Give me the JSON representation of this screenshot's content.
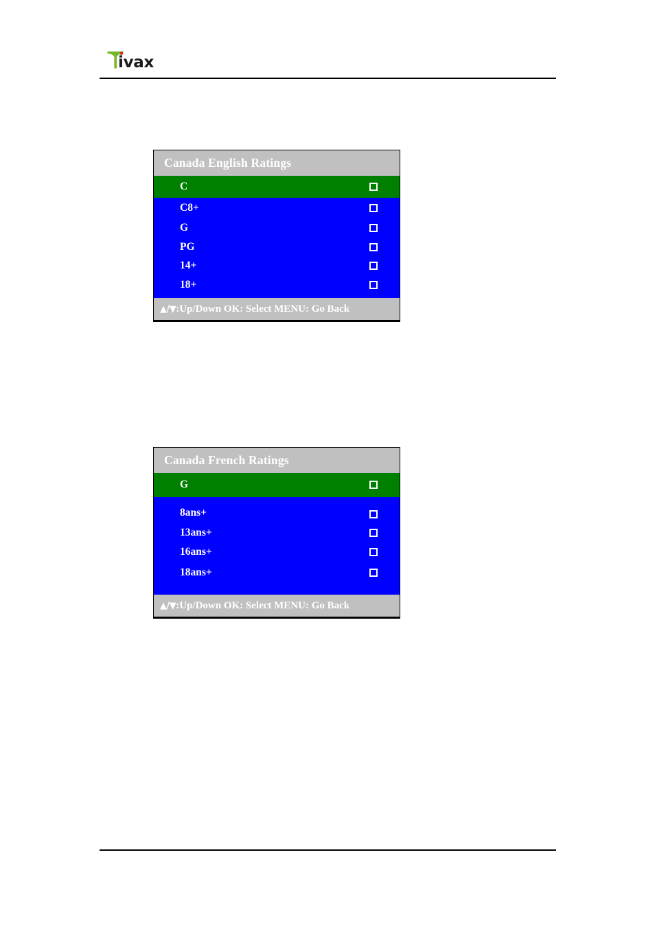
{
  "brand": {
    "logo_text": "ivax",
    "logo_mark": "tivax-t-icon",
    "logo_dot_color": "#d42e12",
    "logo_mark_color": "#76b82a"
  },
  "colors": {
    "header_bg": "#c0c0c0",
    "footer_bg": "#c0c0c0",
    "list_bg": "#0000ff",
    "selected_bg": "#008000",
    "text": "#ffffff",
    "border": "#000000"
  },
  "panels": [
    {
      "id": "canada-english-ratings",
      "title": "Canada English Ratings",
      "items": [
        {
          "label": "C",
          "checked": false,
          "selected": true
        },
        {
          "label": "C8+",
          "checked": false,
          "selected": false
        },
        {
          "label": "G",
          "checked": false,
          "selected": false
        },
        {
          "label": "PG",
          "checked": false,
          "selected": false
        },
        {
          "label": "14+",
          "checked": false,
          "selected": false
        },
        {
          "label": "18+",
          "checked": false,
          "selected": false
        }
      ],
      "footer": {
        "arrows": "▲/▼",
        "text": ":Up/Down OK: Select MENU: Go Back"
      }
    },
    {
      "id": "canada-french-ratings",
      "title": "Canada French Ratings",
      "items": [
        {
          "label": "G",
          "checked": false,
          "selected": true
        },
        {
          "label": "8ans+",
          "checked": false,
          "selected": false
        },
        {
          "label": "13ans+",
          "checked": false,
          "selected": false
        },
        {
          "label": "16ans+",
          "checked": false,
          "selected": false
        },
        {
          "label": "18ans+",
          "checked": false,
          "selected": false
        }
      ],
      "footer": {
        "arrows": "▲/▼",
        "text": ":Up/Down OK: Select MENU: Go Back"
      }
    }
  ]
}
